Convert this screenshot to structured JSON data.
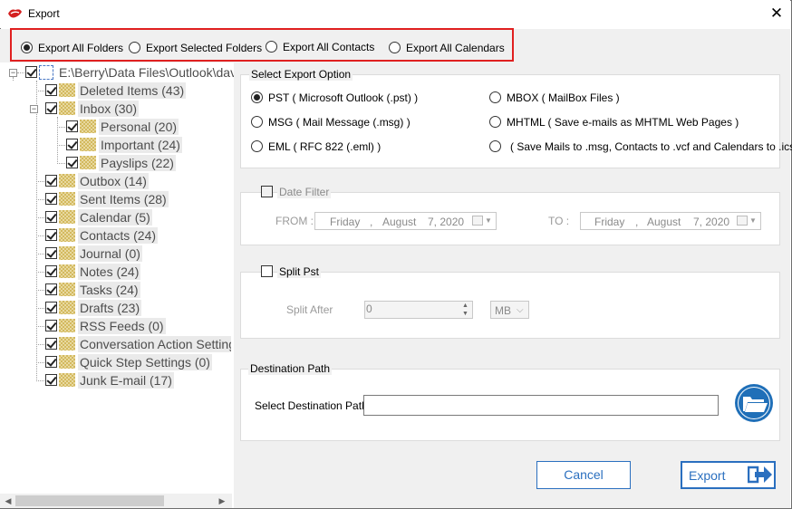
{
  "window": {
    "title": "Export",
    "close_glyph": "✕",
    "app_icon": "app-logo-icon"
  },
  "export_mode": {
    "selected": "Export All Folders",
    "options": [
      "Export All Folders",
      "Export Selected Folders",
      "Export All Contacts",
      "Export All Calendars"
    ]
  },
  "tree": {
    "root": {
      "label": "E:\\Berry\\Data Files\\Outlook\\dav",
      "checked": true,
      "expanded": true
    },
    "items": [
      {
        "label": "Deleted Items (43)",
        "checked": true,
        "level": 1
      },
      {
        "label": "Inbox (30)",
        "checked": true,
        "level": 1,
        "expanded": true
      },
      {
        "label": "Personal (20)",
        "checked": true,
        "level": 2
      },
      {
        "label": "Important (24)",
        "checked": true,
        "level": 2
      },
      {
        "label": "Payslips (22)",
        "checked": true,
        "level": 2
      },
      {
        "label": "Outbox (14)",
        "checked": true,
        "level": 1
      },
      {
        "label": "Sent Items (28)",
        "checked": true,
        "level": 1
      },
      {
        "label": "Calendar (5)",
        "checked": true,
        "level": 1
      },
      {
        "label": "Contacts (24)",
        "checked": true,
        "level": 1
      },
      {
        "label": "Journal (0)",
        "checked": true,
        "level": 1
      },
      {
        "label": "Notes (24)",
        "checked": true,
        "level": 1
      },
      {
        "label": "Tasks (24)",
        "checked": true,
        "level": 1
      },
      {
        "label": "Drafts (23)",
        "checked": true,
        "level": 1
      },
      {
        "label": "RSS Feeds (0)",
        "checked": true,
        "level": 1
      },
      {
        "label": "Conversation Action Settings",
        "checked": true,
        "level": 1
      },
      {
        "label": "Quick Step Settings (0)",
        "checked": true,
        "level": 1
      },
      {
        "label": "Junk E-mail (17)",
        "checked": true,
        "level": 1
      }
    ]
  },
  "export_option": {
    "title": "Select Export Option",
    "selected": "PST ( Microsoft Outlook (.pst) )",
    "left_options": [
      "PST ( Microsoft Outlook (.pst) )",
      "MSG ( Mail Message (.msg) )",
      "EML ( RFC 822 (.eml) )"
    ],
    "right_options": [
      "MBOX ( MailBox Files )",
      "MHTML ( Save e-mails as MHTML Web Pages )",
      "( Save Mails to .msg, Contacts to .vcf and Calendars to .ics )"
    ]
  },
  "date_filter": {
    "label": "Date Filter",
    "enabled": false,
    "from_label": "FROM :",
    "to_label": "TO :",
    "from": {
      "weekday": "Friday",
      "sep": ",",
      "month": "August",
      "day_year": "7, 2020"
    },
    "to": {
      "weekday": "Friday",
      "sep": ",",
      "month": "August",
      "day_year": "7, 2020"
    }
  },
  "split_pst": {
    "label": "Split Pst",
    "enabled": false,
    "after_label": "Split After",
    "value": "0",
    "unit": "MB"
  },
  "destination": {
    "title": "Destination Path",
    "label": "Select Destination Path",
    "value": "",
    "browse_icon": "open-folder-icon"
  },
  "buttons": {
    "cancel": "Cancel",
    "export": "Export"
  },
  "colors": {
    "accent": "#2a6fbf",
    "highlight_border": "#e02020",
    "panel_bg": "#f0f0f0"
  }
}
